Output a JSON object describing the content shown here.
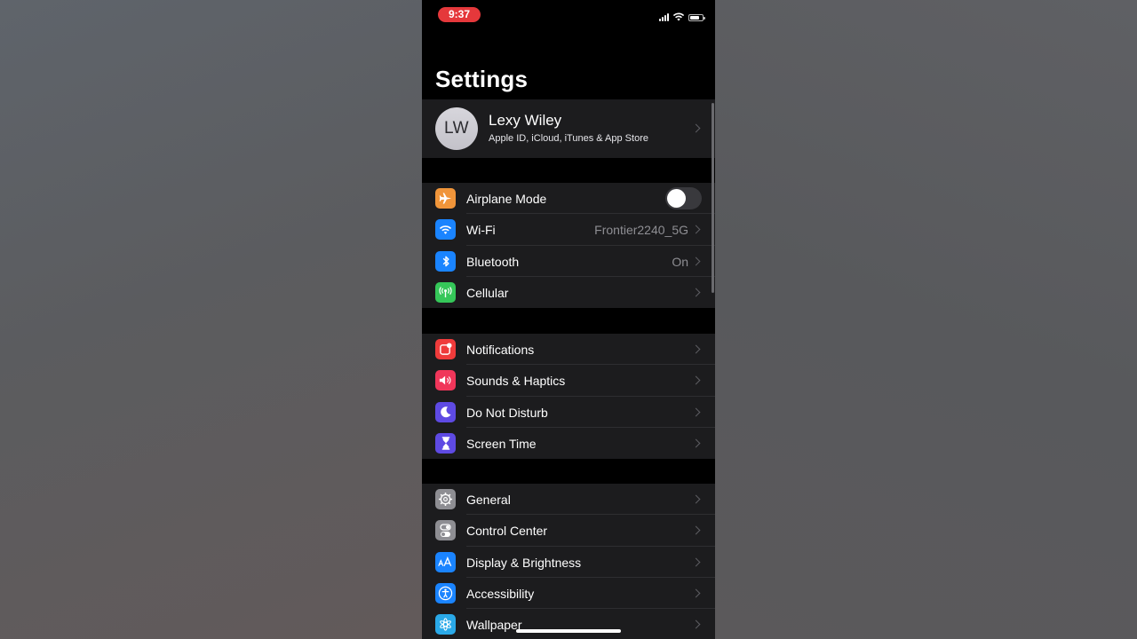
{
  "status_bar": {
    "time": "9:37"
  },
  "page": {
    "title": "Settings"
  },
  "profile": {
    "initials": "LW",
    "name": "Lexy Wiley",
    "subtitle": "Apple ID, iCloud, iTunes & App Store"
  },
  "connectivity": {
    "airplane_mode": {
      "label": "Airplane Mode",
      "enabled": false,
      "icon": "airplane-icon",
      "color": "#f0953a"
    },
    "wifi": {
      "label": "Wi-Fi",
      "value": "Frontier2240_5G",
      "icon": "wifi-icon",
      "color": "#1a84ff"
    },
    "bluetooth": {
      "label": "Bluetooth",
      "value": "On",
      "icon": "bluetooth-icon",
      "color": "#1a84ff"
    },
    "cellular": {
      "label": "Cellular",
      "icon": "antenna-icon",
      "color": "#35c759"
    }
  },
  "alerts": {
    "notifications": {
      "label": "Notifications",
      "icon": "notifications-icon",
      "color": "#ef3b3b"
    },
    "sounds": {
      "label": "Sounds & Haptics",
      "icon": "speaker-icon",
      "color": "#f0365a"
    },
    "dnd": {
      "label": "Do Not Disturb",
      "icon": "moon-icon",
      "color": "#5e4ae3"
    },
    "screen_time": {
      "label": "Screen Time",
      "icon": "hourglass-icon",
      "color": "#5e4ae3"
    }
  },
  "system": {
    "general": {
      "label": "General",
      "icon": "gear-icon",
      "color": "#8e8e93"
    },
    "control_center": {
      "label": "Control Center",
      "icon": "switches-icon",
      "color": "#8e8e93"
    },
    "display": {
      "label": "Display & Brightness",
      "icon": "text-size-icon",
      "color": "#1a84ff"
    },
    "accessibility": {
      "label": "Accessibility",
      "icon": "accessibility-icon",
      "color": "#1a84ff"
    },
    "wallpaper": {
      "label": "Wallpaper",
      "icon": "flower-icon",
      "color": "#2aa9e8"
    }
  }
}
